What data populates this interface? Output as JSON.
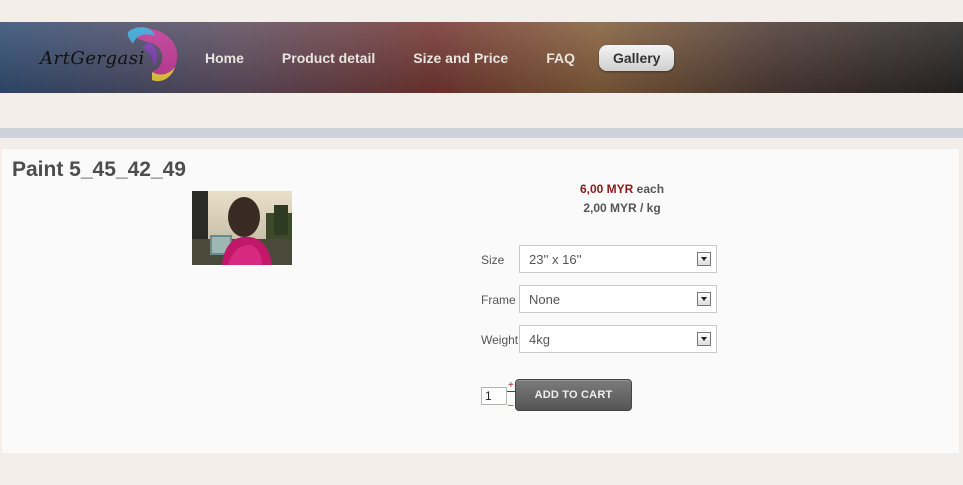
{
  "header": {
    "logo_text": "ArtGergasi",
    "nav": [
      {
        "label": "Home"
      },
      {
        "label": "Product detail"
      },
      {
        "label": "Size and Price"
      },
      {
        "label": "FAQ"
      },
      {
        "label": "Gallery",
        "active": true
      }
    ]
  },
  "product": {
    "title": "Paint 5_45_42_49",
    "price_amount": "6,00 MYR",
    "price_unit": "each",
    "price_per_kg": "2,00 MYR / kg",
    "options": [
      {
        "label": "Size",
        "value": "23'' x 16''"
      },
      {
        "label": "Frame",
        "value": "None"
      },
      {
        "label": "Weight",
        "value": "4kg"
      }
    ],
    "quantity": "1",
    "qty_plus": "+",
    "qty_minus": "–",
    "add_to_cart_label": "ADD TO CART"
  },
  "colors": {
    "price_accent": "#8b1a1a",
    "divider": "#cdd2d8"
  }
}
